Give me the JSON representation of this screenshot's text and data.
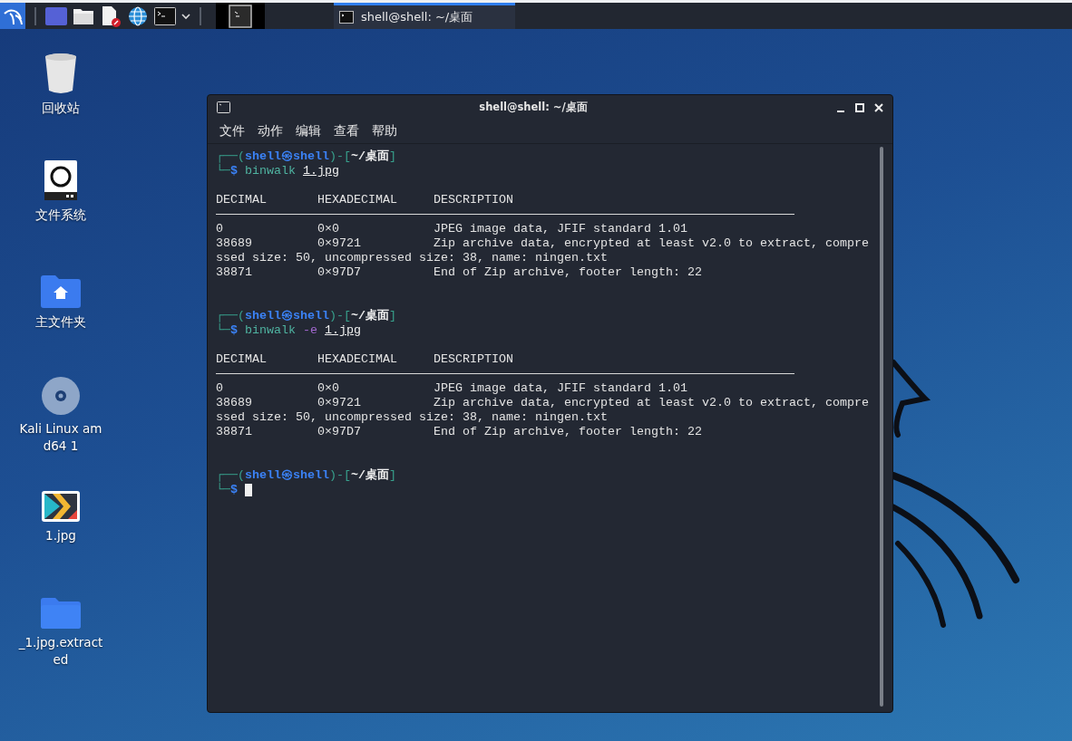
{
  "taskbar": {
    "tasks": [
      {
        "title": "shell@shell: ~/桌面",
        "selected": true
      }
    ]
  },
  "desktop_icons": [
    {
      "kind": "trash",
      "label": "回收站"
    },
    {
      "kind": "drive",
      "label": "文件系统"
    },
    {
      "kind": "home",
      "label": "主文件夹"
    },
    {
      "kind": "disc",
      "label": "Kali Linux amd64 1"
    },
    {
      "kind": "image",
      "label": "1.jpg"
    },
    {
      "kind": "folder",
      "label": "_1.jpg.extracted"
    }
  ],
  "window": {
    "title": "shell@shell: ~/桌面",
    "menu": [
      "文件",
      "动作",
      "编辑",
      "查看",
      "帮助"
    ],
    "terminal": [
      {
        "kind": "prompt",
        "open": "┌──(",
        "user": "shell",
        "at": "㉿",
        "host": "shell",
        "mid": ")-[",
        "path": "~/桌面",
        "close": "]",
        "corner": "└─",
        "dollar": "$",
        "command": "binwalk",
        "args": [
          {
            "kind": "file",
            "text": "1.jpg"
          }
        ]
      },
      {
        "kind": "table",
        "columns": [
          "DECIMAL",
          "HEXADECIMAL",
          "DESCRIPTION"
        ],
        "lines": [
          {
            "cells": [
              "0",
              "0×0",
              "JPEG image data, JFIF standard 1.01"
            ]
          },
          {
            "cells": [
              "38689",
              "0×9721",
              "Zip archive data, encrypted at least v2.0 to extract, compre"
            ]
          },
          {
            "cells": [
              "ssed size: 50, uncompressed size: 38, name: ningen.txt"
            ]
          },
          {
            "cells": [
              "38871",
              "0×97D7",
              "End of Zip archive, footer length: 22"
            ]
          }
        ]
      },
      {
        "kind": "prompt",
        "open": "┌──(",
        "user": "shell",
        "at": "㉿",
        "host": "shell",
        "mid": ")-[",
        "path": "~/桌面",
        "close": "]",
        "corner": "└─",
        "dollar": "$",
        "command": "binwalk",
        "args": [
          {
            "kind": "flag",
            "text": "-e"
          },
          {
            "kind": "file",
            "text": "1.jpg"
          }
        ]
      },
      {
        "kind": "table",
        "columns": [
          "DECIMAL",
          "HEXADECIMAL",
          "DESCRIPTION"
        ],
        "lines": [
          {
            "cells": [
              "0",
              "0×0",
              "JPEG image data, JFIF standard 1.01"
            ]
          },
          {
            "cells": [
              "38689",
              "0×9721",
              "Zip archive data, encrypted at least v2.0 to extract, compre"
            ]
          },
          {
            "cells": [
              "ssed size: 50, uncompressed size: 38, name: ningen.txt"
            ]
          },
          {
            "cells": [
              "38871",
              "0×97D7",
              "End of Zip archive, footer length: 22"
            ]
          }
        ]
      },
      {
        "kind": "prompt",
        "open": "┌──(",
        "user": "shell",
        "at": "㉿",
        "host": "shell",
        "mid": ")-[",
        "path": "~/桌面",
        "close": "]",
        "corner": "└─",
        "dollar": "$",
        "cursor": true
      }
    ]
  }
}
